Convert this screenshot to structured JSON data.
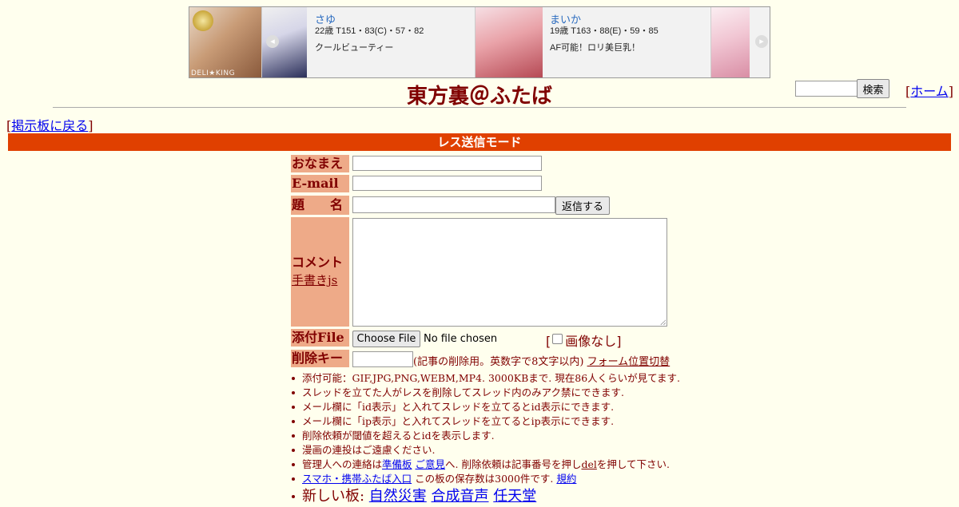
{
  "banner": {
    "brand": "DELI★KING",
    "cards": [
      {
        "name": "さゆ",
        "stats": "22歳 T151・83(C)・57・82",
        "catch": "クールビューティー"
      },
      {
        "name": "まいか",
        "stats": "19歳 T163・88(E)・59・85",
        "catch": "AF可能！ロリ美巨乳！"
      }
    ],
    "prev_arrow": "◂",
    "next_arrow": "▸"
  },
  "header": {
    "title": "東方裏＠ふたば",
    "search_button": "検索",
    "home_link": "ホーム",
    "back_link": "掲示板に戻る"
  },
  "mode_bar": "レス送信モード",
  "form": {
    "name_label": "おなまえ",
    "email_label": "E-mail",
    "subject_label": "題　　名",
    "submit_button": "返信する",
    "comment_label": "コメント",
    "handwriting_link": "手書きjs",
    "file_label": "添付File",
    "file_button": "Choose File",
    "file_status": "No file chosen",
    "no_image_label": "画像なし",
    "delkey_label": "削除キー",
    "delkey_note": "(記事の削除用。英数字で8文字以内)",
    "form_position_toggle": "フォーム位置切替"
  },
  "notes": {
    "n1": "添付可能：GIF,JPG,PNG,WEBM,MP4. 3000KBまで. 現在86人くらいが見てます.",
    "n2": "スレッドを立てた人がレスを削除してスレッド内のみアク禁にできます.",
    "n3": "メール欄に「id表示」と入れてスレッドを立てるとid表示にできます.",
    "n4": "メール欄に「ip表示」と入れてスレッドを立てるとip表示にできます.",
    "n5": "削除依頼が閾値を超えるとidを表示します.",
    "n6": "漫画の連投はご遠慮ください.",
    "n7_a": "管理人への連絡は",
    "n7_link1": "準備板",
    "n7_link2": "ご意見",
    "n7_b": "へ. 削除依頼は記事番号を押し",
    "n7_del": "del",
    "n7_c": "を押して下さい.",
    "n8_link": "スマホ・携帯ふたば入口",
    "n8_text": " この板の保存数は3000件です. ",
    "n8_rules": "規約",
    "n9_label": "新しい板: ",
    "n9_boards": [
      "自然災害",
      "合成音声",
      "任天堂"
    ]
  }
}
